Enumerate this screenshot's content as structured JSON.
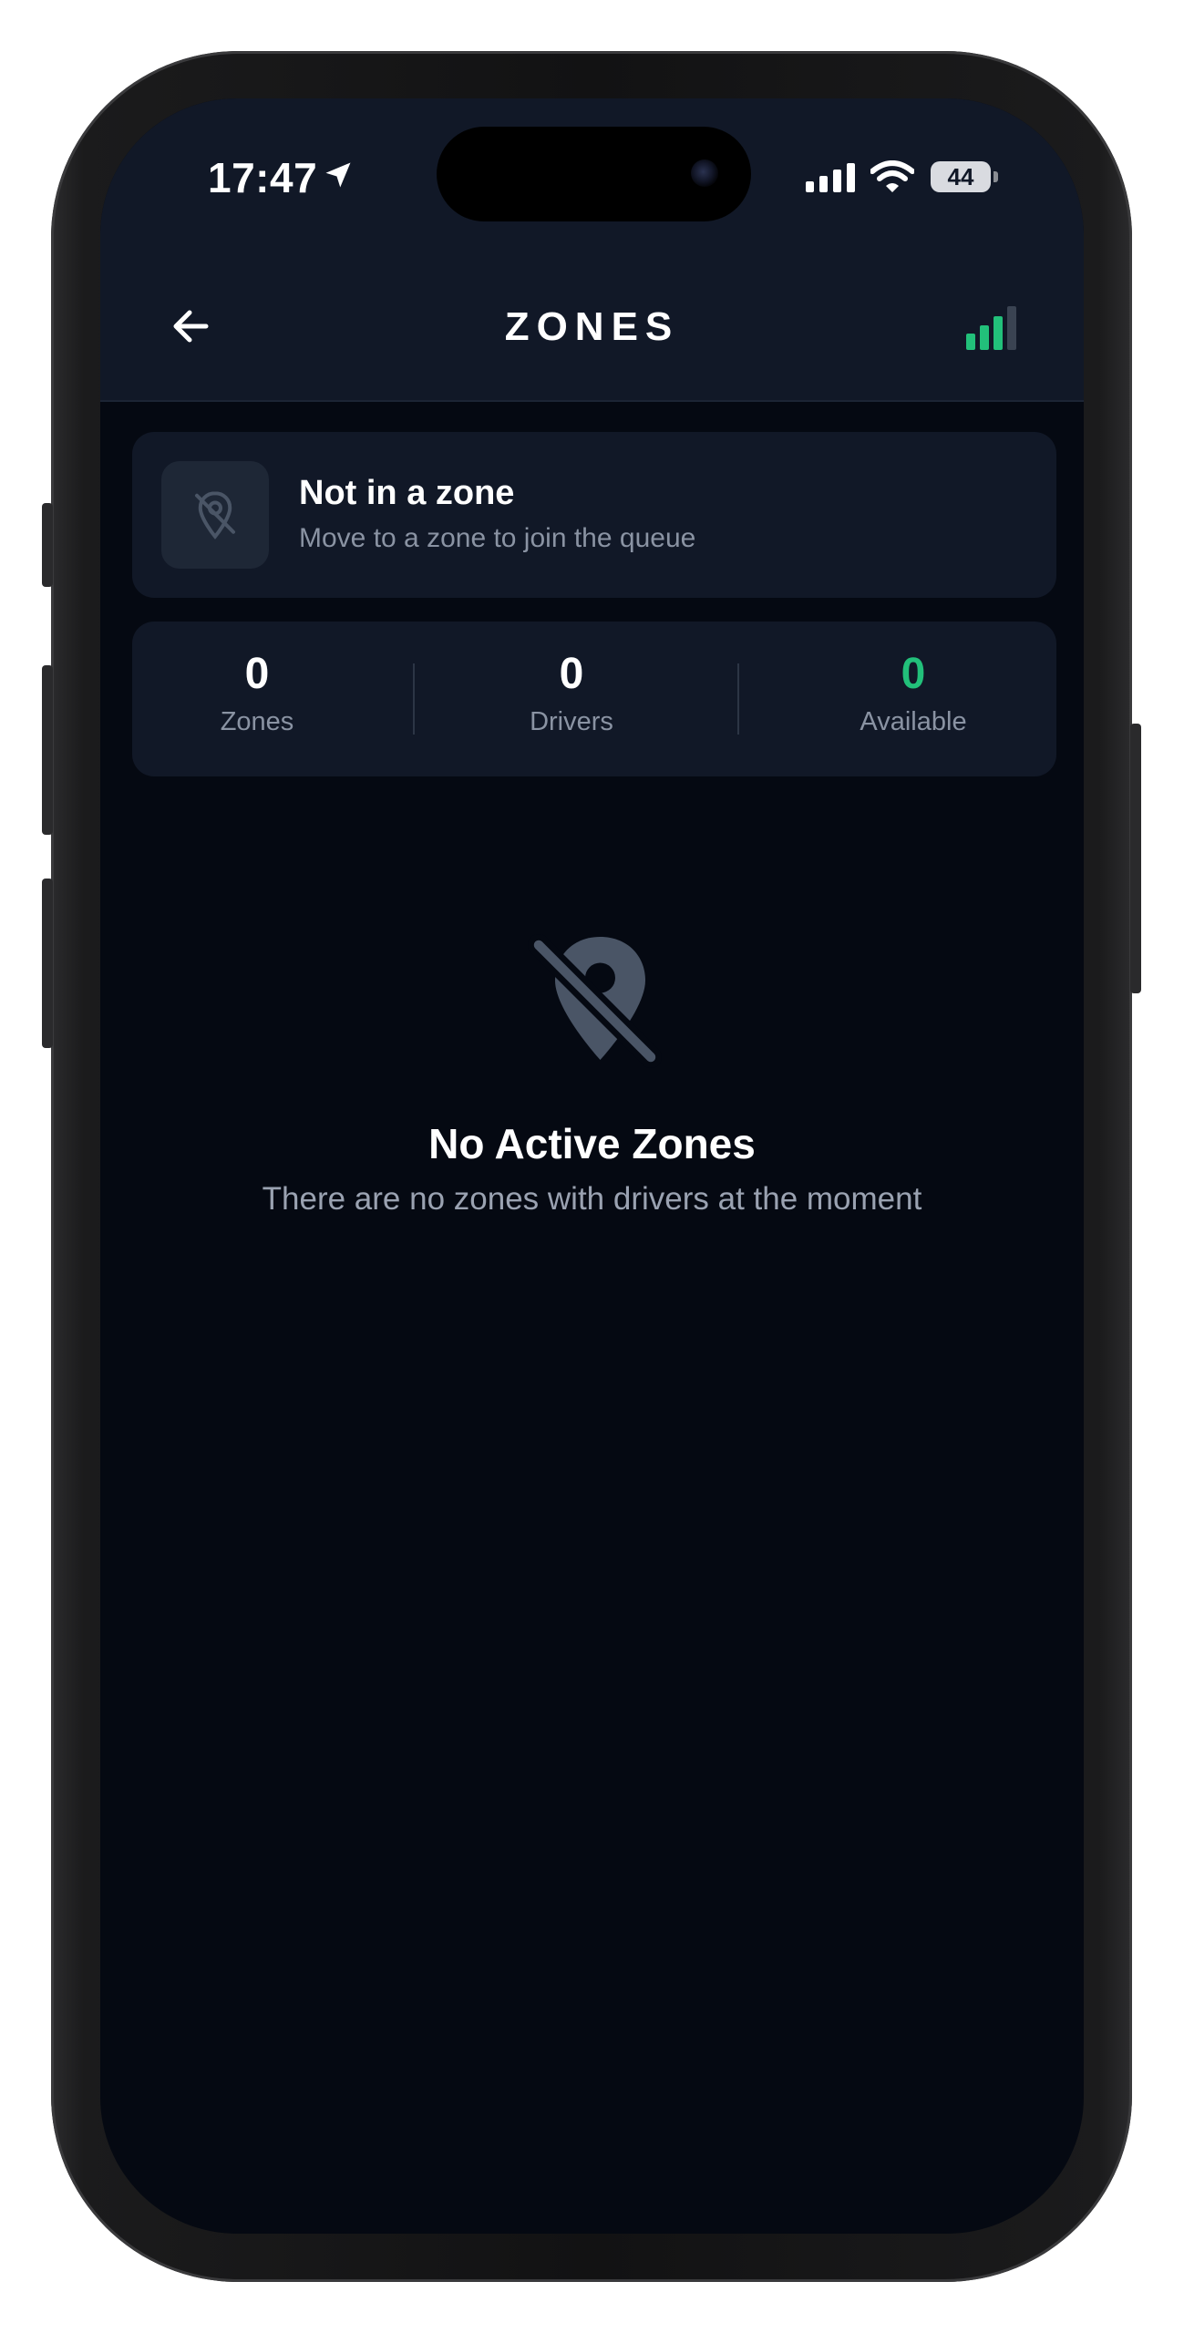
{
  "status_bar": {
    "time": "17:47",
    "battery": "44"
  },
  "header": {
    "title": "ZONES",
    "back_icon": "arrow-left-icon",
    "signal_icon": "signal-bars-icon"
  },
  "zone_status": {
    "title": "Not in a zone",
    "subtitle": "Move to a zone to join the queue",
    "icon": "location-off-icon"
  },
  "stats": [
    {
      "value": "0",
      "label": "Zones"
    },
    {
      "value": "0",
      "label": "Drivers"
    },
    {
      "value": "0",
      "label": "Available"
    }
  ],
  "empty_state": {
    "icon": "location-off-icon",
    "title": "No Active Zones",
    "subtitle": "There are no zones with drivers at the moment"
  },
  "colors": {
    "accent": "#22c07a",
    "background": "#050912",
    "surface": "#111827",
    "muted_text": "#8a93a3"
  }
}
